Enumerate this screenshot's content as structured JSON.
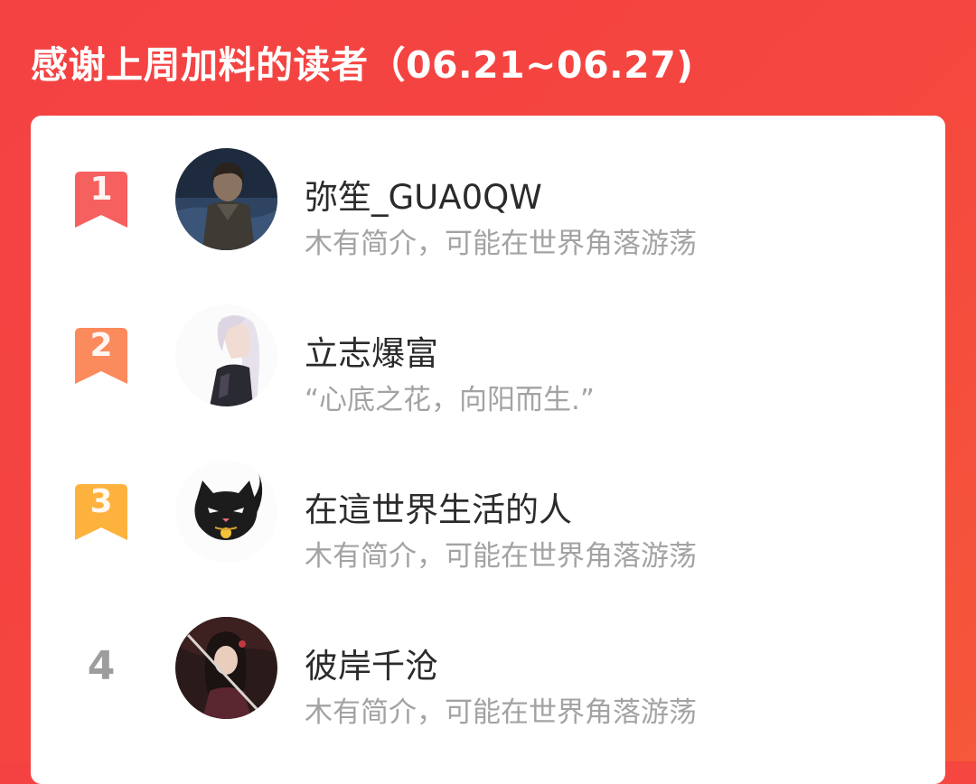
{
  "header": {
    "title": "感谢上周加料的读者（06.21~06.27)"
  },
  "colors": {
    "banner": "#f44243",
    "rank1": "#f6605f",
    "rank2": "#fb8a5d",
    "rank3": "#fdb23e",
    "rank_plain": "#9d9d9d",
    "name_text": "#2b2b2b",
    "bio_text": "#a3a3a3"
  },
  "readers": [
    {
      "rank": "1",
      "name": "弥笙_GUA0QW",
      "bio": "木有简介，可能在世界角落游荡",
      "avatar_icon": "dark-haired-character-avatar"
    },
    {
      "rank": "2",
      "name": "立志爆富",
      "bio": "“心底之花，向阳而生.”",
      "avatar_icon": "silver-haired-character-avatar"
    },
    {
      "rank": "3",
      "name": "在這世界生活的人",
      "bio": "木有简介，可能在世界角落游荡",
      "avatar_icon": "black-cat-bell-avatar"
    },
    {
      "rank": "4",
      "name": "彼岸千沧",
      "bio": "木有简介，可能在世界角落游荡",
      "avatar_icon": "swordswoman-character-avatar"
    }
  ]
}
